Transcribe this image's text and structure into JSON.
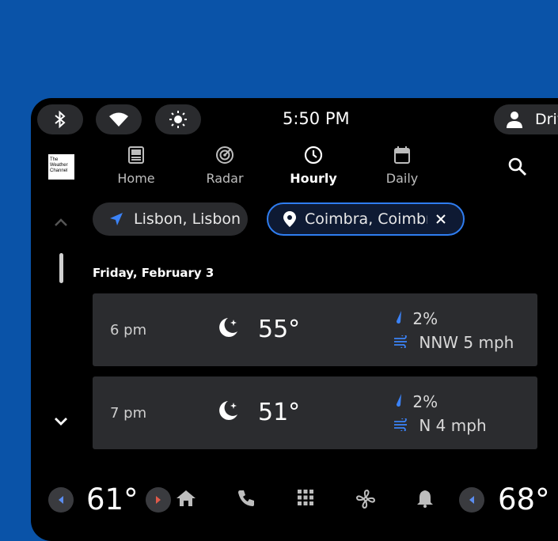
{
  "status_bar": {
    "time": "5:50 PM",
    "profile_label": "Driv"
  },
  "brand": {
    "logo_text": "The Weather Channel"
  },
  "nav": {
    "tabs": [
      {
        "label": "Home"
      },
      {
        "label": "Radar"
      },
      {
        "label": "Hourly"
      },
      {
        "label": "Daily"
      }
    ],
    "active_tab": "Hourly"
  },
  "locations": {
    "current": "Lisbon, Lisbon",
    "selected": "Coimbra, Coimbra"
  },
  "forecast": {
    "date": "Friday, February 3",
    "rows": [
      {
        "hour": "6 pm",
        "temp": "55°",
        "precip": "2%",
        "wind": "NNW 5 mph"
      },
      {
        "hour": "7 pm",
        "temp": "51°",
        "precip": "2%",
        "wind": "N 4 mph"
      }
    ]
  },
  "climate": {
    "driver_temp": "61°",
    "passenger_temp": "68°"
  },
  "colors": {
    "background": "#0a53a8",
    "accent": "#2f7df0",
    "card": "#2b2c2f"
  }
}
